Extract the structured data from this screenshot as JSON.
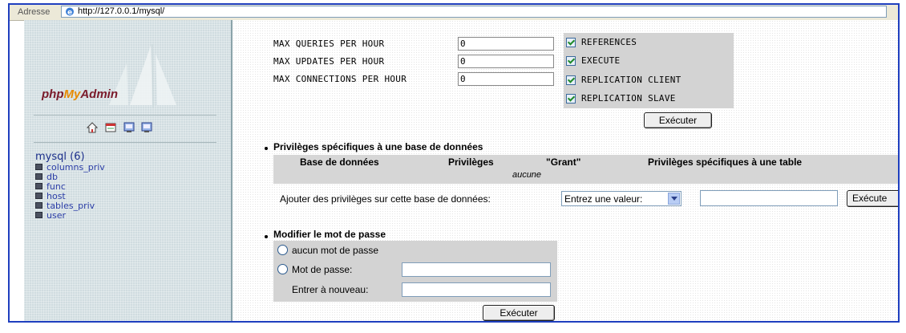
{
  "address_bar": {
    "label": "Adresse",
    "url": "http://127.0.0.1/mysql/"
  },
  "sidebar": {
    "logo": {
      "php": "php",
      "my": "My",
      "admin": "Admin"
    },
    "icons": [
      "home-icon",
      "sql-query-icon",
      "documentation-icon",
      "query-window-icon"
    ],
    "database": "mysql  (6)",
    "tables": [
      "columns_priv",
      "db",
      "func",
      "host",
      "tables_priv",
      "user"
    ]
  },
  "limits": [
    {
      "label": "MAX QUERIES PER HOUR",
      "value": "0"
    },
    {
      "label": "MAX UPDATES PER HOUR",
      "value": "0"
    },
    {
      "label": "MAX CONNECTIONS PER HOUR",
      "value": "0"
    }
  ],
  "privileges": [
    {
      "label": "REFERENCES",
      "checked": true
    },
    {
      "label": "EXECUTE",
      "checked": true
    },
    {
      "label": "REPLICATION CLIENT",
      "checked": true
    },
    {
      "label": "REPLICATION SLAVE",
      "checked": true
    }
  ],
  "execute_label": "Exécuter",
  "db_privileges": {
    "title": "Privilèges spécifiques à une base de données",
    "columns": [
      "Base de données",
      "Privilèges",
      "\"Grant\"",
      "Privilèges spécifiques à une table"
    ],
    "empty_text": "aucune",
    "add_label": "Ajouter des privilèges sur cette base de données:",
    "select_value": "Entrez une valeur:",
    "execute_label": "Exécute"
  },
  "password": {
    "title": "Modifier le mot de passe",
    "no_password": "aucun mot de passe",
    "password_label": "Mot de passe:",
    "retype_label": "Entrer à nouveau:",
    "execute_label": "Exécuter"
  },
  "colors": {
    "frame": "#1f3fbf",
    "sidebar_bg": "#d0dce0",
    "panel_bg": "#d3d3d3",
    "link": "#2a3ca6"
  }
}
